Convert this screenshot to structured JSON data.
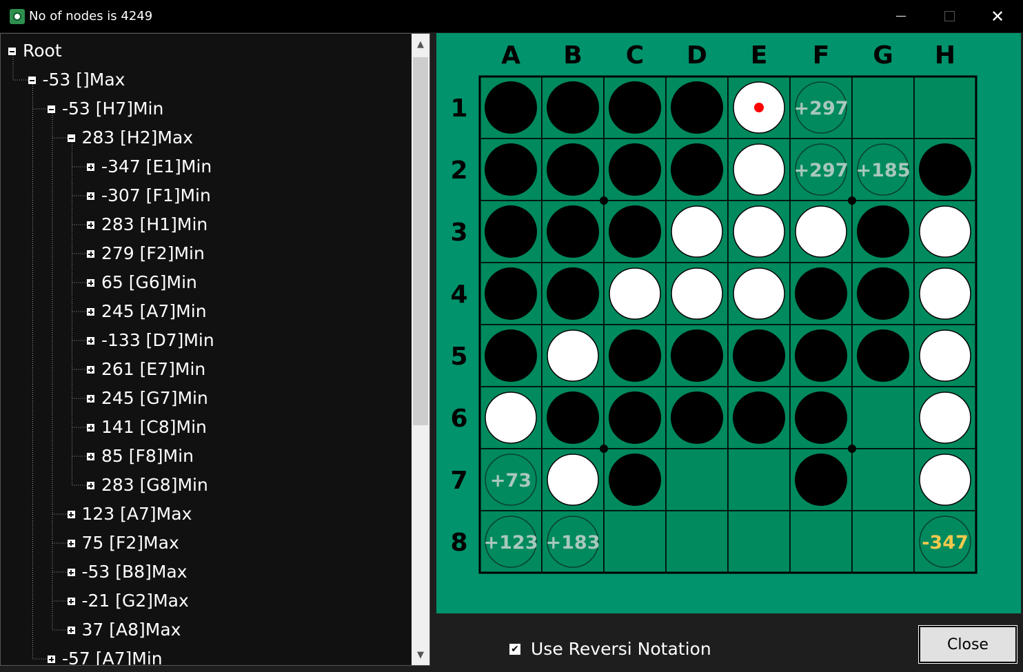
{
  "window": {
    "title": "No of nodes is 4249",
    "icon": "reversi-app-icon",
    "controls": {
      "minimize": "minimize-icon",
      "maximize": "maximize-icon",
      "close": "✕"
    }
  },
  "tree": {
    "nodes": [
      {
        "label": "Root",
        "state": "expanded",
        "level": 0
      },
      {
        "label": "-53 []Max",
        "state": "expanded",
        "level": 1
      },
      {
        "label": "-53 [H7]Min",
        "state": "expanded",
        "level": 2
      },
      {
        "label": "283 [H2]Max",
        "state": "expanded",
        "level": 3
      },
      {
        "label": "-347 [E1]Min",
        "state": "collapsed",
        "level": 4
      },
      {
        "label": "-307 [F1]Min",
        "state": "collapsed",
        "level": 4
      },
      {
        "label": "283 [H1]Min",
        "state": "collapsed",
        "level": 4
      },
      {
        "label": "279 [F2]Min",
        "state": "collapsed",
        "level": 4
      },
      {
        "label": "65 [G6]Min",
        "state": "collapsed",
        "level": 4
      },
      {
        "label": "245 [A7]Min",
        "state": "collapsed",
        "level": 4
      },
      {
        "label": "-133 [D7]Min",
        "state": "collapsed",
        "level": 4
      },
      {
        "label": "261 [E7]Min",
        "state": "collapsed",
        "level": 4
      },
      {
        "label": "245 [G7]Min",
        "state": "collapsed",
        "level": 4
      },
      {
        "label": "141 [C8]Min",
        "state": "collapsed",
        "level": 4
      },
      {
        "label": "85 [F8]Min",
        "state": "collapsed",
        "level": 4
      },
      {
        "label": "283 [G8]Min",
        "state": "collapsed",
        "level": 4
      },
      {
        "label": "123 [A7]Max",
        "state": "collapsed",
        "level": 3
      },
      {
        "label": "75 [F2]Max",
        "state": "collapsed",
        "level": 3
      },
      {
        "label": "-53 [B8]Max",
        "state": "collapsed",
        "level": 3
      },
      {
        "label": "-21 [G2]Max",
        "state": "collapsed",
        "level": 3
      },
      {
        "label": "37 [A8]Max",
        "state": "collapsed",
        "level": 3
      },
      {
        "label": "-57 [A7]Min",
        "state": "collapsed",
        "level": 2
      }
    ],
    "scrollbar": {
      "up_arrow": "▲",
      "down_arrow": "▼",
      "position": 0.0,
      "visible_fraction": 0.63
    }
  },
  "board": {
    "columns": [
      "A",
      "B",
      "C",
      "D",
      "E",
      "F",
      "G",
      "H"
    ],
    "rows": [
      "1",
      "2",
      "3",
      "4",
      "5",
      "6",
      "7",
      "8"
    ],
    "cells": [
      "BBBBWm..",
      "BBBBWmmB",
      "BBBWWWBW",
      "BBWWWBBW",
      "BWBBBBBW",
      "WBBBBB.W",
      "mWB..B.W",
      "mm.....m"
    ],
    "last_move": "E1",
    "move_scores": [
      {
        "cell": "F1",
        "score": "+297",
        "best": false
      },
      {
        "cell": "F2",
        "score": "+297",
        "best": false
      },
      {
        "cell": "G2",
        "score": "+185",
        "best": false
      },
      {
        "cell": "A7",
        "score": "+73",
        "best": false
      },
      {
        "cell": "A8",
        "score": "+123",
        "best": false
      },
      {
        "cell": "B8",
        "score": "+183",
        "best": false
      },
      {
        "cell": "H8",
        "score": "-347",
        "best": true
      }
    ],
    "colors": {
      "board_bg": "#00936c",
      "cell_bg": "#008a5e",
      "score_text": "#a8c8bc",
      "best_score_text": "#f2c94c",
      "last_move_marker": "#ff0000"
    }
  },
  "footer": {
    "reversi_notation": {
      "label": "Use Reversi Notation",
      "checked": true,
      "mark": "✔"
    },
    "close_label": "Close"
  }
}
